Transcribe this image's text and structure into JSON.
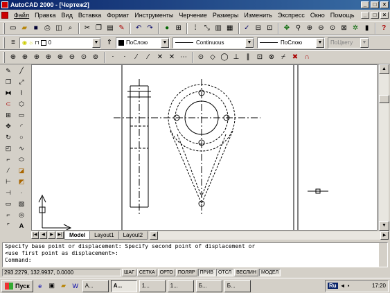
{
  "window": {
    "title": "AutoCAD 2000 - [Чертеж2]",
    "controls": [
      "_",
      "□",
      "×"
    ]
  },
  "menu": {
    "items": [
      "Файл",
      "Правка",
      "Вид",
      "Вставка",
      "Формат",
      "Инструменты",
      "Черчение",
      "Размеры",
      "Изменить",
      "Экспресс",
      "Окно",
      "Помощь"
    ],
    "doc_controls": [
      "_",
      "□",
      "×"
    ]
  },
  "layers_toolbar": {
    "layer_value": "0",
    "color_value": "ПоСлою",
    "linetype_value": "Continuous",
    "lineweight_value": "ПоСлою",
    "plotstyle_value": "ПоЦвету"
  },
  "layout_tabs": {
    "tabs": [
      "Model",
      "Layout1",
      "Layout2"
    ],
    "active": "Model"
  },
  "command": {
    "lines": [
      "Specify base point or displacement: Specify second point of displacement or",
      "<use first point as displacement>:",
      "Command:"
    ]
  },
  "status": {
    "coords": "293.2279, 132.9937, 0.0000",
    "modes": [
      {
        "label": "ШАГ",
        "on": false
      },
      {
        "label": "СЕТКА",
        "on": false
      },
      {
        "label": "ОРТО",
        "on": false
      },
      {
        "label": "ПОЛЯР",
        "on": false
      },
      {
        "label": "ПРИВ",
        "on": true
      },
      {
        "label": "ОТСЛ",
        "on": true
      },
      {
        "label": "ВЕСЛИН",
        "on": false
      },
      {
        "label": "МОДЕЛ",
        "on": true
      }
    ]
  },
  "taskbar": {
    "start_label": "Пуск",
    "tasks": [
      {
        "label": "A...",
        "active": false
      },
      {
        "label": "A...",
        "active": true
      },
      {
        "label": "1...",
        "active": false
      },
      {
        "label": "1...",
        "active": false
      },
      {
        "label": "Б...",
        "active": false
      },
      {
        "label": "Б...",
        "active": false
      }
    ],
    "lang": "Ru",
    "clock": "17:20"
  }
}
